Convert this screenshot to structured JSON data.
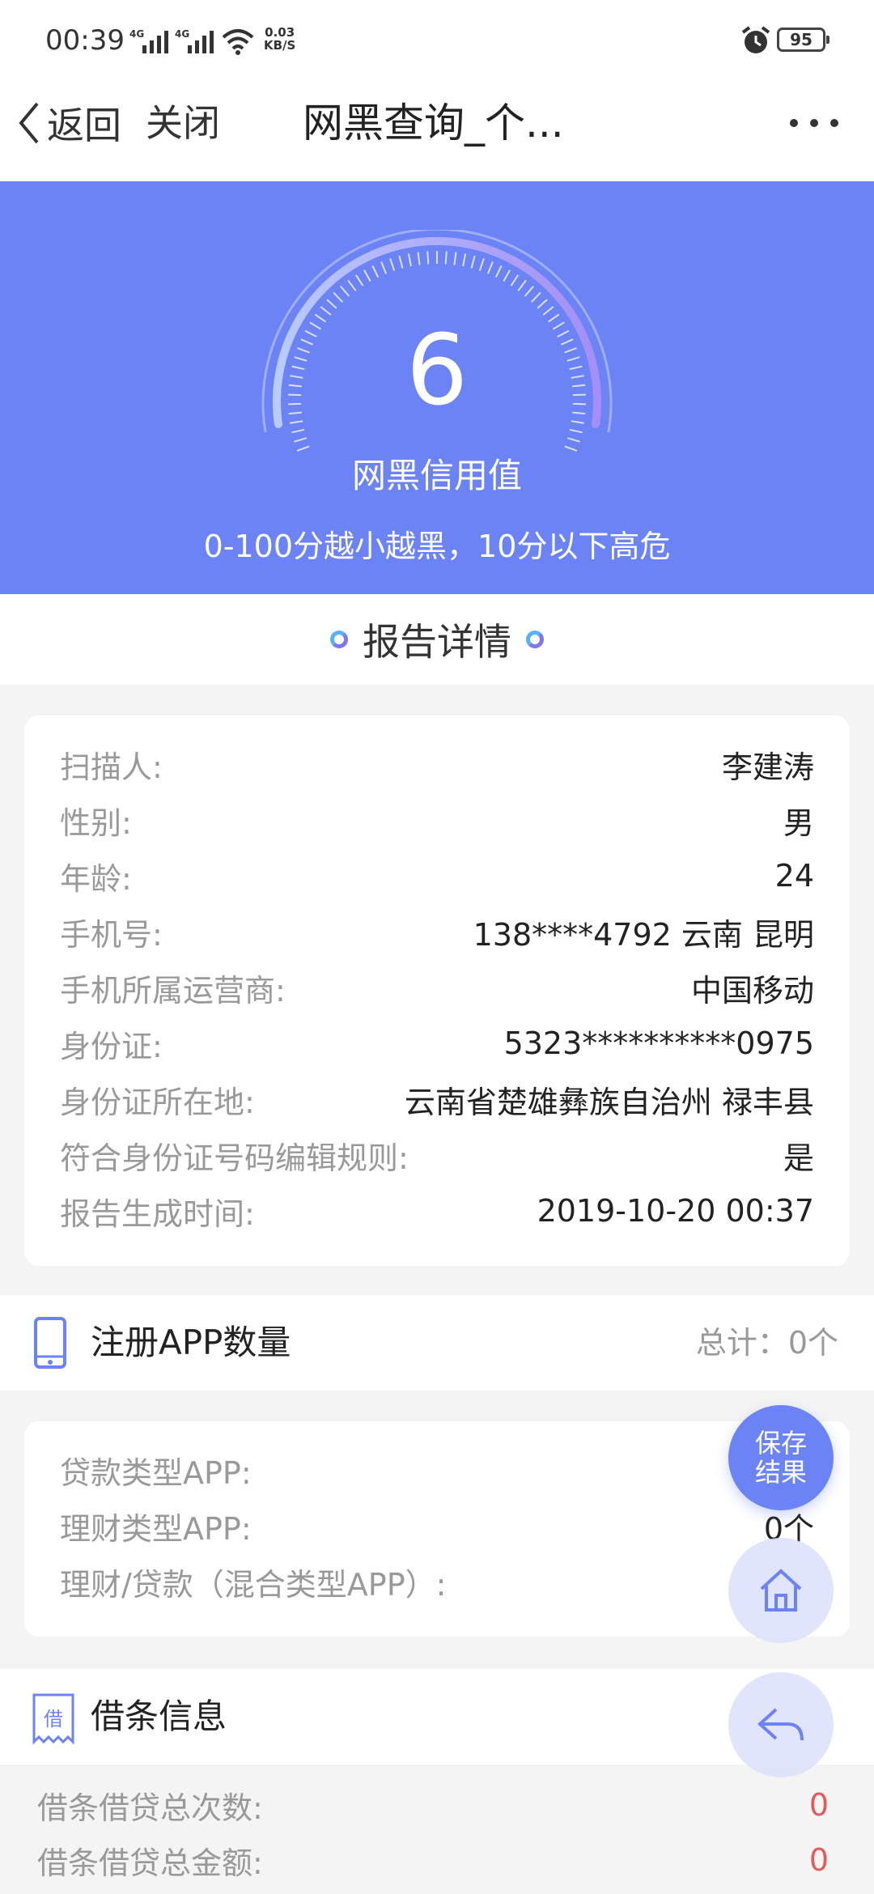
{
  "status_bar": {
    "time": "00:39",
    "signal1": "4G",
    "signal2": "4G",
    "net_speed_value": "0.03",
    "net_speed_unit": "KB/S",
    "battery": "95"
  },
  "nav": {
    "back_label": "返回",
    "close_label": "关闭",
    "title": "网黑查询_个..."
  },
  "hero": {
    "score": "6",
    "score_label": "网黑信用值",
    "hint": "0-100分越小越黑，10分以下高危",
    "score_fraction": 0.06
  },
  "report": {
    "title": "报告详情",
    "rows": [
      {
        "k": "扫描人:",
        "v": "李建涛"
      },
      {
        "k": "性别:",
        "v": "男"
      },
      {
        "k": "年龄:",
        "v": "24"
      },
      {
        "k": "手机号:",
        "v": "138****4792 云南 昆明"
      },
      {
        "k": "手机所属运营商:",
        "v": "中国移动"
      },
      {
        "k": "身份证:",
        "v": "5323**********0975"
      },
      {
        "k": "身份证所在地:",
        "v": "云南省楚雄彝族自治州 禄丰县"
      },
      {
        "k": "符合身份证号码编辑规则:",
        "v": "是"
      },
      {
        "k": "报告生成时间:",
        "v": "2019-10-20 00:37"
      }
    ]
  },
  "apps": {
    "title": "注册APP数量",
    "total": "总计：0个",
    "rows": [
      {
        "k": "贷款类型APP:",
        "v": ""
      },
      {
        "k": "理财类型APP:",
        "v": "0个"
      },
      {
        "k": "理财/贷款（混合类型APP）:",
        "v": ""
      }
    ]
  },
  "iou": {
    "title": "借条信息",
    "icon_char": "借",
    "rows": [
      {
        "k": "借条借贷总次数:",
        "v": "0"
      },
      {
        "k": "借条借贷总金额:",
        "v": "0"
      }
    ]
  },
  "fab": {
    "save_line1": "保存",
    "save_line2": "结果"
  },
  "colors": {
    "accent": "#6c83f5",
    "danger": "#e25a5a"
  }
}
